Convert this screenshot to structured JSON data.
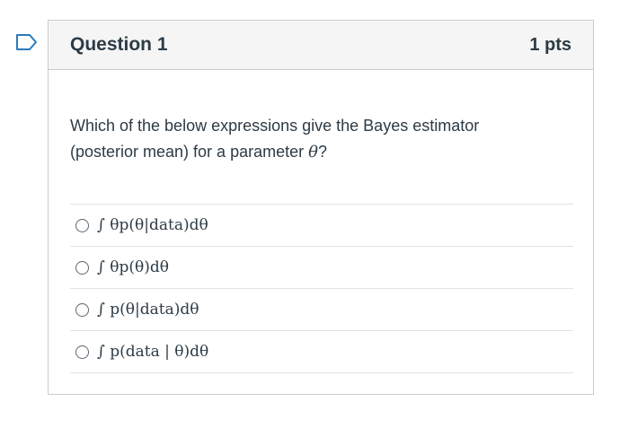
{
  "question": {
    "title": "Question 1",
    "points": "1 pts",
    "text_before": "Which of the below expressions give the Bayes estimator (posterior mean) for a parameter ",
    "text_theta": "θ",
    "text_after": "?"
  },
  "answers": [
    {
      "expr": "∫ θp(θ|data)dθ"
    },
    {
      "expr": "∫ θp(θ)dθ"
    },
    {
      "expr": "∫ p(θ|data)dθ"
    },
    {
      "expr": "∫ p(data | θ)dθ"
    }
  ],
  "icons": {
    "flag": "bookmark-flag-icon",
    "radio": "radio-unchecked-icon"
  },
  "colors": {
    "accent": "#2b7abc",
    "header_bg": "#f5f5f5",
    "border": "#c7cdd1",
    "text": "#2d3b45"
  }
}
